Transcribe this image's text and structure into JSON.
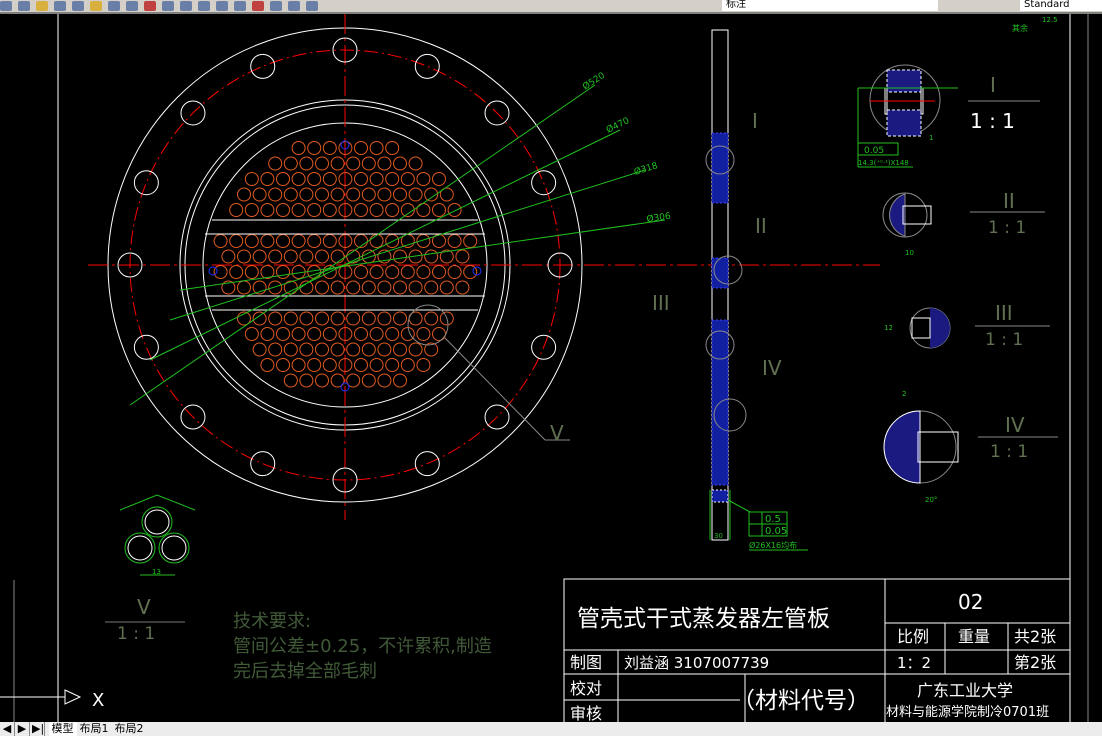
{
  "toolbar": {
    "layer": "标注",
    "text_style": "Standard"
  },
  "tabs": {
    "nav": [
      "◀",
      "▶",
      "▶|"
    ],
    "items": [
      "模型",
      "布局1",
      "布局2"
    ],
    "active": 0
  },
  "drawing": {
    "roughness_note": "其余",
    "roughness_value": "12.5",
    "diameters": [
      "Ø520",
      "Ø470",
      "Ø318",
      "Ø306"
    ],
    "section_marks": [
      "I",
      "II",
      "III",
      "IV",
      "V"
    ],
    "details": [
      {
        "label": "I",
        "scale": "1 : 1"
      },
      {
        "label": "II",
        "scale": "1 : 1"
      },
      {
        "label": "III",
        "scale": "1 : 1"
      },
      {
        "label": "IV",
        "scale": "1 : 1"
      },
      {
        "label": "V",
        "scale": "1 : 1"
      }
    ],
    "detail_I_tol": "0.05",
    "detail_I_note": "14.3(⁺⁰·¹)X148",
    "side_tol": [
      "0.5",
      "0.05"
    ],
    "side_note": "Ø26X16均布",
    "side_dim": "30",
    "dim_small": [
      "1",
      "10",
      "12",
      "20°",
      "2",
      "13"
    ],
    "axis_label": "X",
    "tech_title": "技术要求:",
    "tech_lines": [
      "管间公差±0.25，不许累积,制造",
      "完后去掉全部毛刺"
    ]
  },
  "title_block": {
    "title": "管壳式干式蒸发器左管板",
    "number": "02",
    "scale_label": "比例",
    "weight_label": "重量",
    "total": "共2张",
    "sheet": "第2张",
    "scale_value": "1：2",
    "drawn_label": "制图",
    "drawn_by": "刘益涵   3107007739",
    "check_label": "校对",
    "review_label": "审核",
    "material": "（材料代号）",
    "school": "广东工业大学",
    "class": "材料与能源学院制冷0701班"
  },
  "colors": {
    "bg": "#000000",
    "line": "#ffffff",
    "center": "#ff0000",
    "dim": "#00c000",
    "tube": "#ff6020",
    "hatch": "#2020c0"
  }
}
